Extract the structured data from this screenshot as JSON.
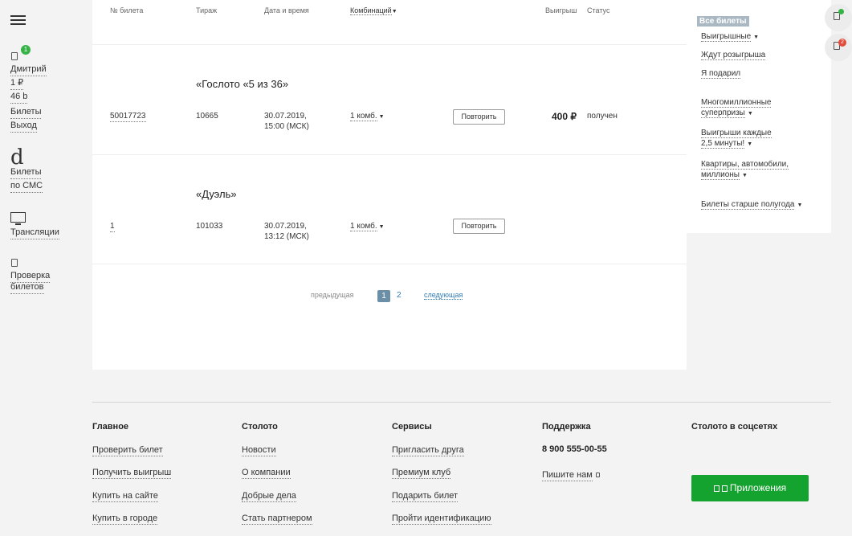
{
  "sidebar": {
    "badge_count": "1",
    "user_name": "Дмитрий",
    "balance": "1 ₽",
    "bonus": "46 b",
    "tickets_link": "Билеты",
    "logout_link": "Выход",
    "logo_glyph": "d",
    "sms_line1": "Билеты",
    "sms_line2": "по СМС",
    "broadcasts": "Трансляции",
    "check_line1": "Проверка",
    "check_line2": "билетов"
  },
  "table": {
    "headers": {
      "ticket_no": "№ билета",
      "draw": "Тираж",
      "datetime": "Дата и время",
      "combinations": "Комбинаций",
      "winnings": "Выигрыш",
      "status": "Статус"
    },
    "rows": [
      {
        "game": "«Гослото «5 из 36»",
        "ticket": "50017723",
        "draw": "10665",
        "date": "30.07.2019,",
        "time": "15:00 (МСК)",
        "combinations": "1 комб.",
        "repeat": "Повторить",
        "prize": "400 ₽",
        "status": "получен"
      },
      {
        "game": "«Дуэль»",
        "ticket": "1",
        "draw": "101033",
        "date": "30.07.2019,",
        "time": "13:12 (МСК)",
        "combinations": "1 комб.",
        "repeat": "Повторить",
        "prize": "",
        "status": ""
      }
    ]
  },
  "pagination": {
    "prev": "предыдущая",
    "current": "1",
    "page2": "2",
    "next": "следующая"
  },
  "filters": {
    "all": "Все билеты",
    "winning": "Выигрышные",
    "awaiting": "Ждут розыгрыша",
    "gifted": "Я подарил",
    "multi_line1": "Многомиллионные",
    "multi_line2": "суперпризы",
    "every_line1": "Выигрыши каждые",
    "every_line2": "2,5 минуты!",
    "flats_line1": "Квартиры, автомобили,",
    "flats_line2": "миллионы",
    "older": "Билеты старше полугода"
  },
  "right_icons": {
    "badge_red": "2"
  },
  "footer": {
    "col1": {
      "title": "Главное",
      "links": [
        "Проверить билет",
        "Получить выигрыш",
        "Купить на сайте",
        "Купить в городе"
      ]
    },
    "col2": {
      "title": "Столото",
      "links": [
        "Новости",
        "О компании",
        "Добрые дела",
        "Стать партнером"
      ]
    },
    "col3": {
      "title": "Сервисы",
      "links": [
        "Пригласить друга",
        "Премиум клуб",
        "Подарить билет",
        "Пройти идентификацию"
      ]
    },
    "col4": {
      "title": "Поддержка",
      "phone": "8 900 555-00-55",
      "write": "Пишите нам"
    },
    "col5": {
      "title": "Столото в соцсетях",
      "apps": "Приложения"
    }
  },
  "colors": {
    "accent_green": "#15a32f",
    "page_bg": "#f3f3f3",
    "pager_active": "#6a8fa6",
    "badge_red": "#e24b3b"
  }
}
